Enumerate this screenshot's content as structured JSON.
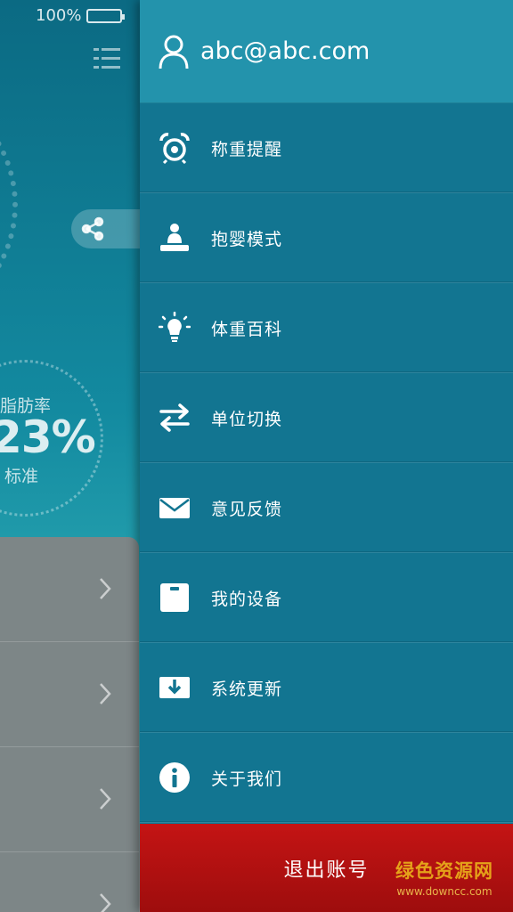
{
  "status_bar": {
    "battery": "100%"
  },
  "background": {
    "fat_label": "脂肪率",
    "fat_value": "23%",
    "fat_status": "标准"
  },
  "drawer": {
    "user_email": "abc@abc.com",
    "items": [
      {
        "label": "称重提醒",
        "icon": "alarm-clock-icon"
      },
      {
        "label": "抱婴模式",
        "icon": "baby-hold-icon"
      },
      {
        "label": "体重百科",
        "icon": "lightbulb-icon"
      },
      {
        "label": "单位切换",
        "icon": "swap-arrows-icon"
      },
      {
        "label": "意见反馈",
        "icon": "envelope-icon"
      },
      {
        "label": "我的设备",
        "icon": "scale-device-icon"
      },
      {
        "label": "系统更新",
        "icon": "download-icon"
      },
      {
        "label": "关于我们",
        "icon": "info-icon"
      }
    ],
    "logout_label": "退出账号"
  },
  "watermark": {
    "title": "绿色资源网",
    "url": "www.downcc.com"
  },
  "colors": {
    "drawer_bg": "#127591",
    "header_bg": "#2393ac",
    "logout_bg": "#b01010"
  }
}
